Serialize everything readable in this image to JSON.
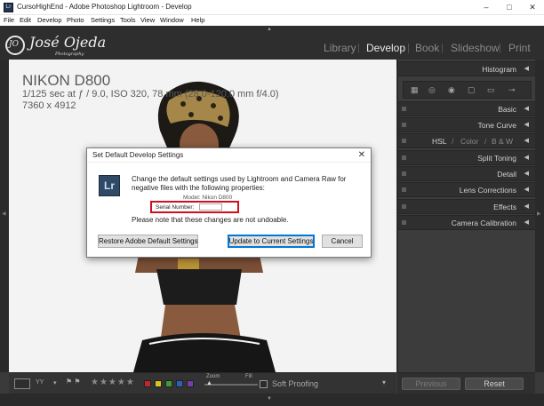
{
  "window": {
    "title": "CursoHighEnd - Adobe Photoshop Lightroom - Develop",
    "app_icon": "Lr",
    "controls": [
      "–",
      "□",
      "✕"
    ]
  },
  "menu": [
    "File",
    "Edit",
    "Develop",
    "Photo",
    "Settings",
    "Tools",
    "View",
    "Window",
    "Help"
  ],
  "identity_plate": {
    "name": "José Ojeda",
    "subtitle": "Photography",
    "monogram": "JO"
  },
  "modules": {
    "items": [
      "Library",
      "Develop",
      "Book",
      "Slideshow",
      "Print"
    ],
    "active": "Develop",
    "separator": "|"
  },
  "photo_info": {
    "camera": "NIKON D800",
    "exposure": "1/125 sec at ƒ / 9.0, ISO 320, 78 mm (28.0-120.0 mm f/4.0)",
    "dimensions": "7360 x 4912"
  },
  "right_panel": {
    "histogram": "Histogram",
    "panels": [
      "Basic",
      "Tone Curve",
      "Split Toning",
      "Detail",
      "Lens Corrections",
      "Effects",
      "Camera Calibration"
    ],
    "hsl": {
      "hsl": "HSL",
      "sep": "/",
      "color": "Color",
      "bw": "B & W"
    },
    "tools": [
      "▦",
      "◎",
      "◉",
      "▢",
      "▭",
      "⊸"
    ]
  },
  "bottom_toolbar": {
    "view_grid": "▭",
    "view_compare": "YY",
    "stars": "★★★★★",
    "flag_colors": [
      "#c0262d",
      "#d8c41f",
      "#3d9a34",
      "#2d5fb8",
      "#7a3aa8"
    ],
    "zoom_label": "Zoom",
    "zoom_fill": "Fill",
    "soft_proofing": "Soft Proofing",
    "dropdown": "▾"
  },
  "buttons": {
    "previous": "Previous",
    "reset": "Reset"
  },
  "dialog": {
    "title": "Set Default Develop Settings",
    "close": "✕",
    "logo": "Lr",
    "message": "Change the default settings used by Lightroom and Camera Raw for negative files with the following properties:",
    "model_line": "Model: Nikon D800",
    "serial_label": "Serial Number:",
    "serial_value": "",
    "note": "Please note that these changes are not undoable.",
    "restore_button": "Restore Adobe Default Settings",
    "update_button": "Update to Current Settings",
    "cancel_button": "Cancel"
  },
  "colors": {
    "lightroom_bg": "#3a3a3a",
    "panel_header": "#2f2f2f",
    "highlight_box": "#d0101c",
    "default_button_border": "#0078d7"
  }
}
